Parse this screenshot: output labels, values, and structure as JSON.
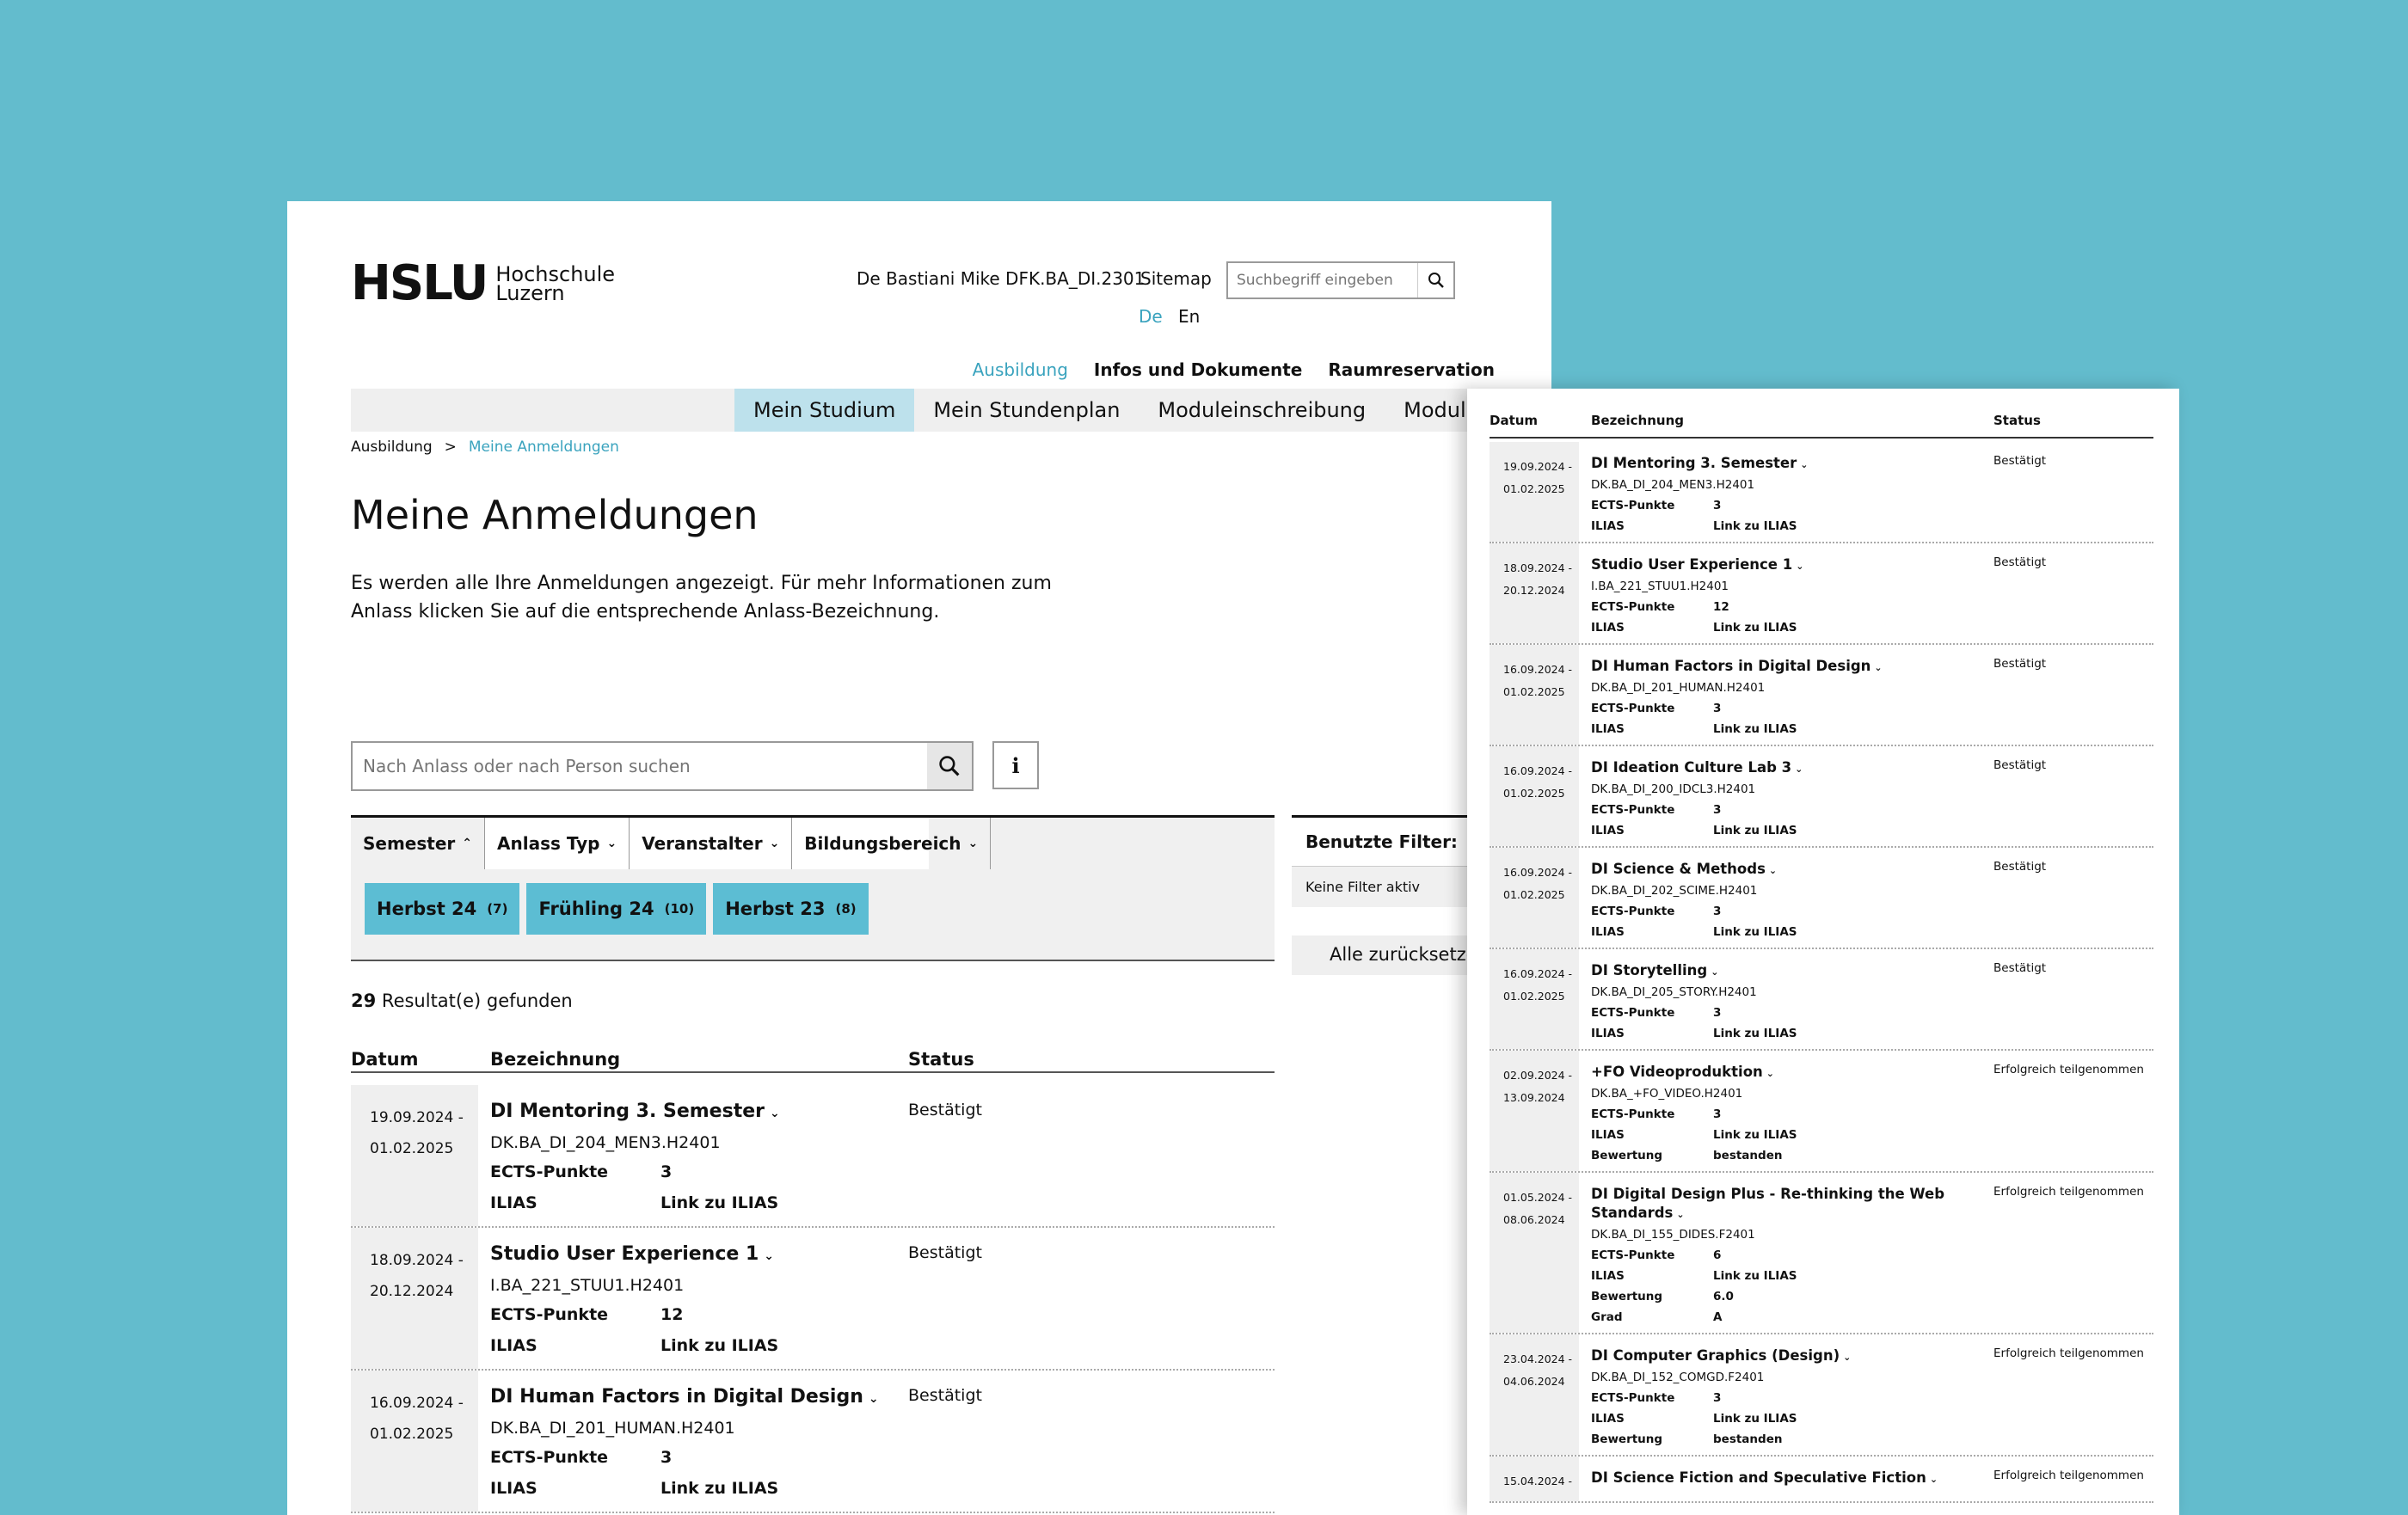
{
  "header": {
    "logo_mark": "HSLU",
    "logo_line1": "Hochschule",
    "logo_line2": "Luzern",
    "user": "De Bastiani Mike DFK.BA_DI.2301",
    "sitemap": "Sitemap",
    "search_placeholder": "Suchbegriff eingeben",
    "lang_de": "De",
    "lang_en": "En"
  },
  "top_nav": [
    "Ausbildung",
    "Infos und Dokumente",
    "Raumreservation"
  ],
  "main_nav": [
    "Mein Studium",
    "Mein Stundenplan",
    "Moduleinschreibung",
    "Modulanlässe such"
  ],
  "breadcrumb": {
    "root": "Ausbildung",
    "sep": ">",
    "current": "Meine Anmeldungen"
  },
  "page": {
    "title": "Meine Anmeldungen",
    "intro": "Es werden alle Ihre Anmeldungen angezeigt. Für mehr Informationen zum Anlass klicken Sie auf die entsprechende Anlass-Bezeichnung.",
    "search_placeholder": "Nach Anlass oder nach Person suchen",
    "info": "i"
  },
  "filters": {
    "tabs": [
      "Semester",
      "Anlass Typ",
      "Veranstalter",
      "Bildungsbereich"
    ],
    "chips": [
      {
        "label": "Herbst 24",
        "count": "(7)"
      },
      {
        "label": "Frühling 24",
        "count": "(10)"
      },
      {
        "label": "Herbst 23",
        "count": "(8)"
      }
    ],
    "used_title": "Benutzte Filter:",
    "used_none": "Keine Filter aktiv",
    "reset": "Alle zurücksetzen"
  },
  "results": {
    "count": "29",
    "label": "Resultat(e) gefunden"
  },
  "table_head": {
    "date": "Datum",
    "name": "Bezeichnung",
    "status": "Status"
  },
  "rows": [
    {
      "d1": "19.09.2024 -",
      "d2": "01.02.2025",
      "title": "DI Mentoring 3. Semester",
      "code": "DK.BA_DI_204_MEN3.H2401",
      "ects_label": "ECTS-Punkte",
      "ects": "3",
      "ilias_label": "ILIAS",
      "ilias": "Link zu ILIAS",
      "status": "Bestätigt"
    },
    {
      "d1": "18.09.2024 -",
      "d2": "20.12.2024",
      "title": "Studio User Experience 1",
      "code": "I.BA_221_STUU1.H2401",
      "ects_label": "ECTS-Punkte",
      "ects": "12",
      "ilias_label": "ILIAS",
      "ilias": "Link zu ILIAS",
      "status": "Bestätigt"
    },
    {
      "d1": "16.09.2024 -",
      "d2": "01.02.2025",
      "title": "DI Human Factors in Digital Design",
      "code": "DK.BA_DI_201_HUMAN.H2401",
      "ects_label": "ECTS-Punkte",
      "ects": "3",
      "ilias_label": "ILIAS",
      "ilias": "Link zu ILIAS",
      "status": "Bestätigt"
    }
  ],
  "overlay": {
    "head": {
      "date": "Datum",
      "name": "Bezeichnung",
      "status": "Status"
    },
    "rows": [
      {
        "d1": "19.09.2024 -",
        "d2": "01.02.2025",
        "title": "DI Mentoring 3. Semester",
        "code": "DK.BA_DI_204_MEN3.H2401",
        "status": "Bestätigt",
        "kv": [
          [
            "ECTS-Punkte",
            "3"
          ],
          [
            "ILIAS",
            "Link zu ILIAS"
          ]
        ]
      },
      {
        "d1": "18.09.2024 -",
        "d2": "20.12.2024",
        "title": "Studio User Experience 1",
        "code": "I.BA_221_STUU1.H2401",
        "status": "Bestätigt",
        "kv": [
          [
            "ECTS-Punkte",
            "12"
          ],
          [
            "ILIAS",
            "Link zu ILIAS"
          ]
        ]
      },
      {
        "d1": "16.09.2024 -",
        "d2": "01.02.2025",
        "title": "DI Human Factors in Digital Design",
        "code": "DK.BA_DI_201_HUMAN.H2401",
        "status": "Bestätigt",
        "kv": [
          [
            "ECTS-Punkte",
            "3"
          ],
          [
            "ILIAS",
            "Link zu ILIAS"
          ]
        ]
      },
      {
        "d1": "16.09.2024 -",
        "d2": "01.02.2025",
        "title": "DI Ideation Culture Lab 3",
        "code": "DK.BA_DI_200_IDCL3.H2401",
        "status": "Bestätigt",
        "kv": [
          [
            "ECTS-Punkte",
            "3"
          ],
          [
            "ILIAS",
            "Link zu ILIAS"
          ]
        ]
      },
      {
        "d1": "16.09.2024 -",
        "d2": "01.02.2025",
        "title": "DI Science & Methods",
        "code": "DK.BA_DI_202_SCIME.H2401",
        "status": "Bestätigt",
        "kv": [
          [
            "ECTS-Punkte",
            "3"
          ],
          [
            "ILIAS",
            "Link zu ILIAS"
          ]
        ]
      },
      {
        "d1": "16.09.2024 -",
        "d2": "01.02.2025",
        "title": "DI Storytelling",
        "code": "DK.BA_DI_205_STORY.H2401",
        "status": "Bestätigt",
        "kv": [
          [
            "ECTS-Punkte",
            "3"
          ],
          [
            "ILIAS",
            "Link zu ILIAS"
          ]
        ]
      },
      {
        "d1": "02.09.2024 -",
        "d2": "13.09.2024",
        "title": "+FO Videoproduktion",
        "code": "DK.BA_+FO_VIDEO.H2401",
        "status": "Erfolgreich teilgenommen",
        "kv": [
          [
            "ECTS-Punkte",
            "3"
          ],
          [
            "ILIAS",
            "Link zu ILIAS"
          ],
          [
            "Bewertung",
            "bestanden"
          ]
        ]
      },
      {
        "d1": "01.05.2024 -",
        "d2": "08.06.2024",
        "title": "DI Digital Design Plus - Re-thinking the Web Standards",
        "code": "DK.BA_DI_155_DIDES.F2401",
        "status": "Erfolgreich teilgenommen",
        "kv": [
          [
            "ECTS-Punkte",
            "6"
          ],
          [
            "ILIAS",
            "Link zu ILIAS"
          ],
          [
            "Bewertung",
            "6.0"
          ],
          [
            "Grad",
            "A"
          ]
        ]
      },
      {
        "d1": "23.04.2024 -",
        "d2": "04.06.2024",
        "title": "DI Computer Graphics (Design)",
        "code": "DK.BA_DI_152_COMGD.F2401",
        "status": "Erfolgreich teilgenommen",
        "kv": [
          [
            "ECTS-Punkte",
            "3"
          ],
          [
            "ILIAS",
            "Link zu ILIAS"
          ],
          [
            "Bewertung",
            "bestanden"
          ]
        ]
      },
      {
        "d1": "15.04.2024 -",
        "d2": "",
        "title": "DI Science Fiction and Speculative Fiction",
        "code": "",
        "status": "Erfolgreich teilgenommen",
        "kv": []
      }
    ]
  }
}
